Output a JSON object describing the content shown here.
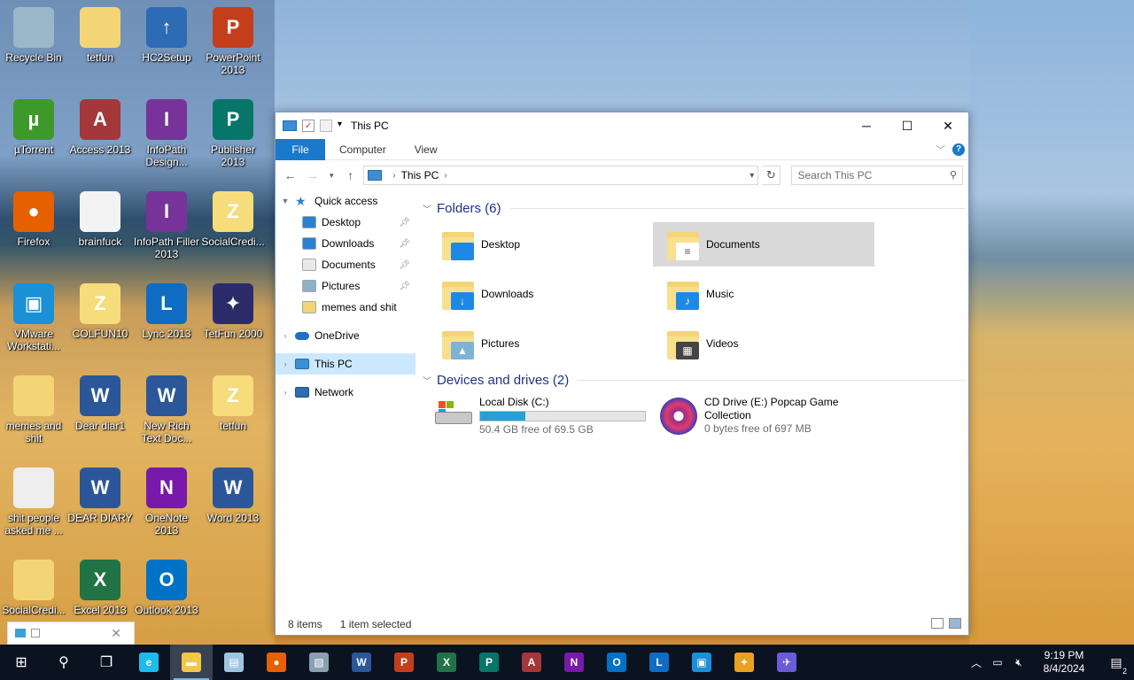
{
  "colors": {
    "accent": "#1979ca",
    "selection": "#cce8ff",
    "tile_selected": "#d9d9d9",
    "drive_bar": "#26a0da",
    "taskbar": "#0b1220"
  },
  "desktop_icons": [
    {
      "label": "Recycle Bin",
      "icon": "recycle-bin-icon"
    },
    {
      "label": "tetfun",
      "icon": "folder-icon"
    },
    {
      "label": "HC2Setup",
      "icon": "installer-icon"
    },
    {
      "label": "PowerPoint 2013",
      "icon": "powerpoint-icon"
    },
    {
      "label": "µTorrent",
      "icon": "utorrent-icon"
    },
    {
      "label": "Access 2013",
      "icon": "access-icon"
    },
    {
      "label": "InfoPath Design...",
      "icon": "infopath-icon"
    },
    {
      "label": "Publisher 2013",
      "icon": "publisher-icon"
    },
    {
      "label": "Firefox",
      "icon": "firefox-icon"
    },
    {
      "label": "brainfuck",
      "icon": "text-file-icon"
    },
    {
      "label": "InfoPath Filler 2013",
      "icon": "infopath-icon"
    },
    {
      "label": "SocialCredi...",
      "icon": "zip-folder-icon"
    },
    {
      "label": "VMware Workstati...",
      "icon": "vmware-icon"
    },
    {
      "label": "COLFUN10",
      "icon": "zip-folder-icon"
    },
    {
      "label": "Lync 2013",
      "icon": "lync-icon"
    },
    {
      "label": "TetFun 2000",
      "icon": "game-icon"
    },
    {
      "label": "memes and shit",
      "icon": "folder-image-icon"
    },
    {
      "label": "Dear diar1",
      "icon": "word-document-icon"
    },
    {
      "label": "New Rich Text Doc...",
      "icon": "rich-text-icon"
    },
    {
      "label": "tetfun",
      "icon": "zip-folder-icon"
    },
    {
      "label": "shit people asked me ...",
      "icon": "image-file-icon"
    },
    {
      "label": "DEAR DIARY",
      "icon": "word-document-icon"
    },
    {
      "label": "OneNote 2013",
      "icon": "onenote-icon"
    },
    {
      "label": "Word 2013",
      "icon": "word-icon"
    },
    {
      "label": "SocialCredi...",
      "icon": "folder-icon"
    },
    {
      "label": "Excel 2013",
      "icon": "excel-icon"
    },
    {
      "label": "Outlook 2013",
      "icon": "outlook-icon"
    }
  ],
  "window": {
    "title": "This PC",
    "ribbon_tabs": [
      "File",
      "Computer",
      "View"
    ],
    "help": "?",
    "address": {
      "crumb": "This PC"
    },
    "search": {
      "placeholder": "Search This PC"
    },
    "nav": {
      "quick_access": "Quick access",
      "qa_items": [
        {
          "label": "Desktop",
          "pinned": true
        },
        {
          "label": "Downloads",
          "pinned": true
        },
        {
          "label": "Documents",
          "pinned": true
        },
        {
          "label": "Pictures",
          "pinned": true
        },
        {
          "label": "memes and shit",
          "pinned": false
        }
      ],
      "onedrive": "OneDrive",
      "this_pc": "This PC",
      "network": "Network"
    },
    "folders_header": "Folders (6)",
    "folders": [
      {
        "label": "Desktop",
        "icon": "desktop-folder-icon",
        "selected": false
      },
      {
        "label": "Documents",
        "icon": "documents-folder-icon",
        "selected": true
      },
      {
        "label": "Downloads",
        "icon": "downloads-folder-icon",
        "selected": false
      },
      {
        "label": "Music",
        "icon": "music-folder-icon",
        "selected": false
      },
      {
        "label": "Pictures",
        "icon": "pictures-folder-icon",
        "selected": false
      },
      {
        "label": "Videos",
        "icon": "videos-folder-icon",
        "selected": false
      }
    ],
    "devices_header": "Devices and drives (2)",
    "drives": [
      {
        "name": "Local Disk (C:)",
        "free": "50.4 GB free of 69.5 GB",
        "used_fraction": 0.275,
        "icon": "hard-drive-icon"
      },
      {
        "name": "CD Drive (E:) Popcap Game Collection",
        "free": "0 bytes free of 697 MB",
        "icon": "cd-drive-icon"
      }
    ],
    "status": {
      "items": "8 items",
      "selected": "1 item selected"
    }
  },
  "taskbar": {
    "apps": [
      {
        "icon": "start-icon",
        "glyph": "⊞"
      },
      {
        "icon": "search-icon",
        "glyph": "⚲"
      },
      {
        "icon": "task-view-icon",
        "glyph": "❐"
      },
      {
        "icon": "internet-explorer-icon",
        "glyph": "e"
      },
      {
        "icon": "file-explorer-icon",
        "glyph": "▬"
      },
      {
        "icon": "notepad-icon",
        "glyph": "▤"
      },
      {
        "icon": "firefox-icon",
        "glyph": "●"
      },
      {
        "icon": "photos-icon",
        "glyph": "▧"
      },
      {
        "icon": "word-icon",
        "glyph": "W"
      },
      {
        "icon": "powerpoint-icon",
        "glyph": "P"
      },
      {
        "icon": "excel-icon",
        "glyph": "X"
      },
      {
        "icon": "publisher-icon",
        "glyph": "P"
      },
      {
        "icon": "access-icon",
        "glyph": "A"
      },
      {
        "icon": "onenote-icon",
        "glyph": "N"
      },
      {
        "icon": "outlook-icon",
        "glyph": "O"
      },
      {
        "icon": "lync-icon",
        "glyph": "L"
      },
      {
        "icon": "vmware-icon",
        "glyph": "▣"
      },
      {
        "icon": "game-icon",
        "glyph": "✦"
      },
      {
        "icon": "app-icon",
        "glyph": "✈"
      }
    ],
    "clock": {
      "time": "9:19 PM",
      "date": "8/4/2024"
    },
    "notification_count": "2"
  }
}
